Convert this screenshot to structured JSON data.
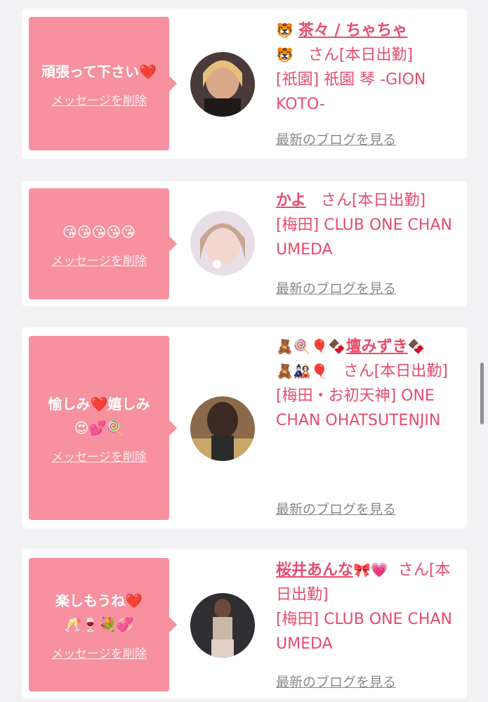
{
  "delete_label": "メッセージを削除",
  "blog_label": "最新のブログを見る",
  "cards": [
    {
      "message_text": "頑張って下さい",
      "message_emoji": "❤️",
      "name_emoji": "🐯",
      "name": "茶々 / ちゃちゃ",
      "name_emoji2": "🐯",
      "suffix": "さん[本日出勤]",
      "shop": "[祇園] 祇園 琴 -GION KOTO-",
      "avatar_icon": "avatar-photo"
    },
    {
      "message_emoji": "😘😘😘😘😘",
      "name": "かよ",
      "suffix": "さん[本日出勤]",
      "shop": "[梅田] CLUB ONE CHAN UMEDA",
      "avatar_icon": "avatar-photo"
    },
    {
      "message_text": "愉しみ❤️嬉しみ",
      "message_emoji": "😍💕🍭",
      "name_prefix": "🧸🍭🎈🍫",
      "name": "壇みずき",
      "name_emoji": "🍫",
      "name_line2_emoji": "🧸🎎🎈",
      "suffix": "さん[本日出勤]",
      "shop": "[梅田・お初天神] ONE CHAN OHATSUTENJIN",
      "avatar_icon": "avatar-photo"
    },
    {
      "message_text": "楽しもうね❤️",
      "message_emoji": "🥂🍷💐💞",
      "name": "桜井あんな",
      "name_emoji": "🎀💗",
      "suffix": "さん[本日出勤]",
      "shop": "[梅田] CLUB ONE CHAN UMEDA",
      "avatar_icon": "avatar-photo"
    }
  ]
}
